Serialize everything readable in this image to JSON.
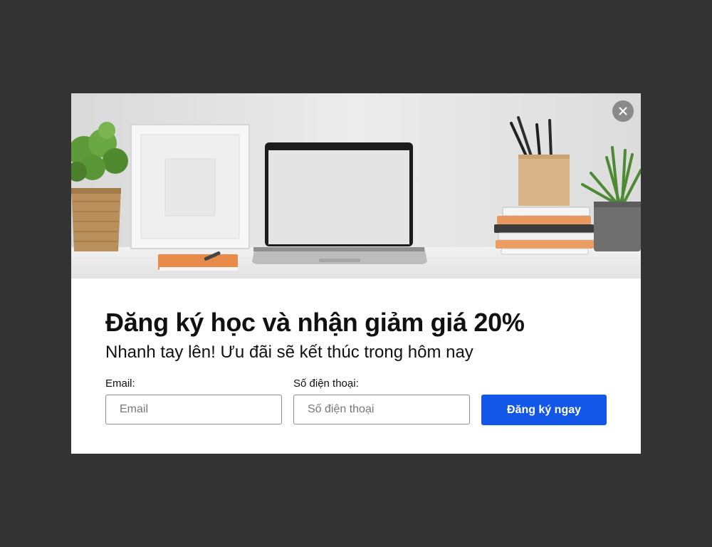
{
  "popup": {
    "hero_image": "desk-workspace-photo",
    "close_icon": "close-icon",
    "title": "Đăng ký học và nhận giảm giá 20%",
    "subtitle": "Nhanh tay lên! Ưu đãi sẽ kết thúc trong hôm nay",
    "form": {
      "email_label": "Email:",
      "email_placeholder": "Email",
      "email_value": "",
      "phone_label": "Số điện thoại:",
      "phone_placeholder": "Số điện thoại",
      "phone_value": "",
      "submit_label": "Đăng ký ngay"
    }
  },
  "colors": {
    "backdrop": "#333333",
    "button": "#1357e8",
    "close_button": "#8a8a8a"
  }
}
